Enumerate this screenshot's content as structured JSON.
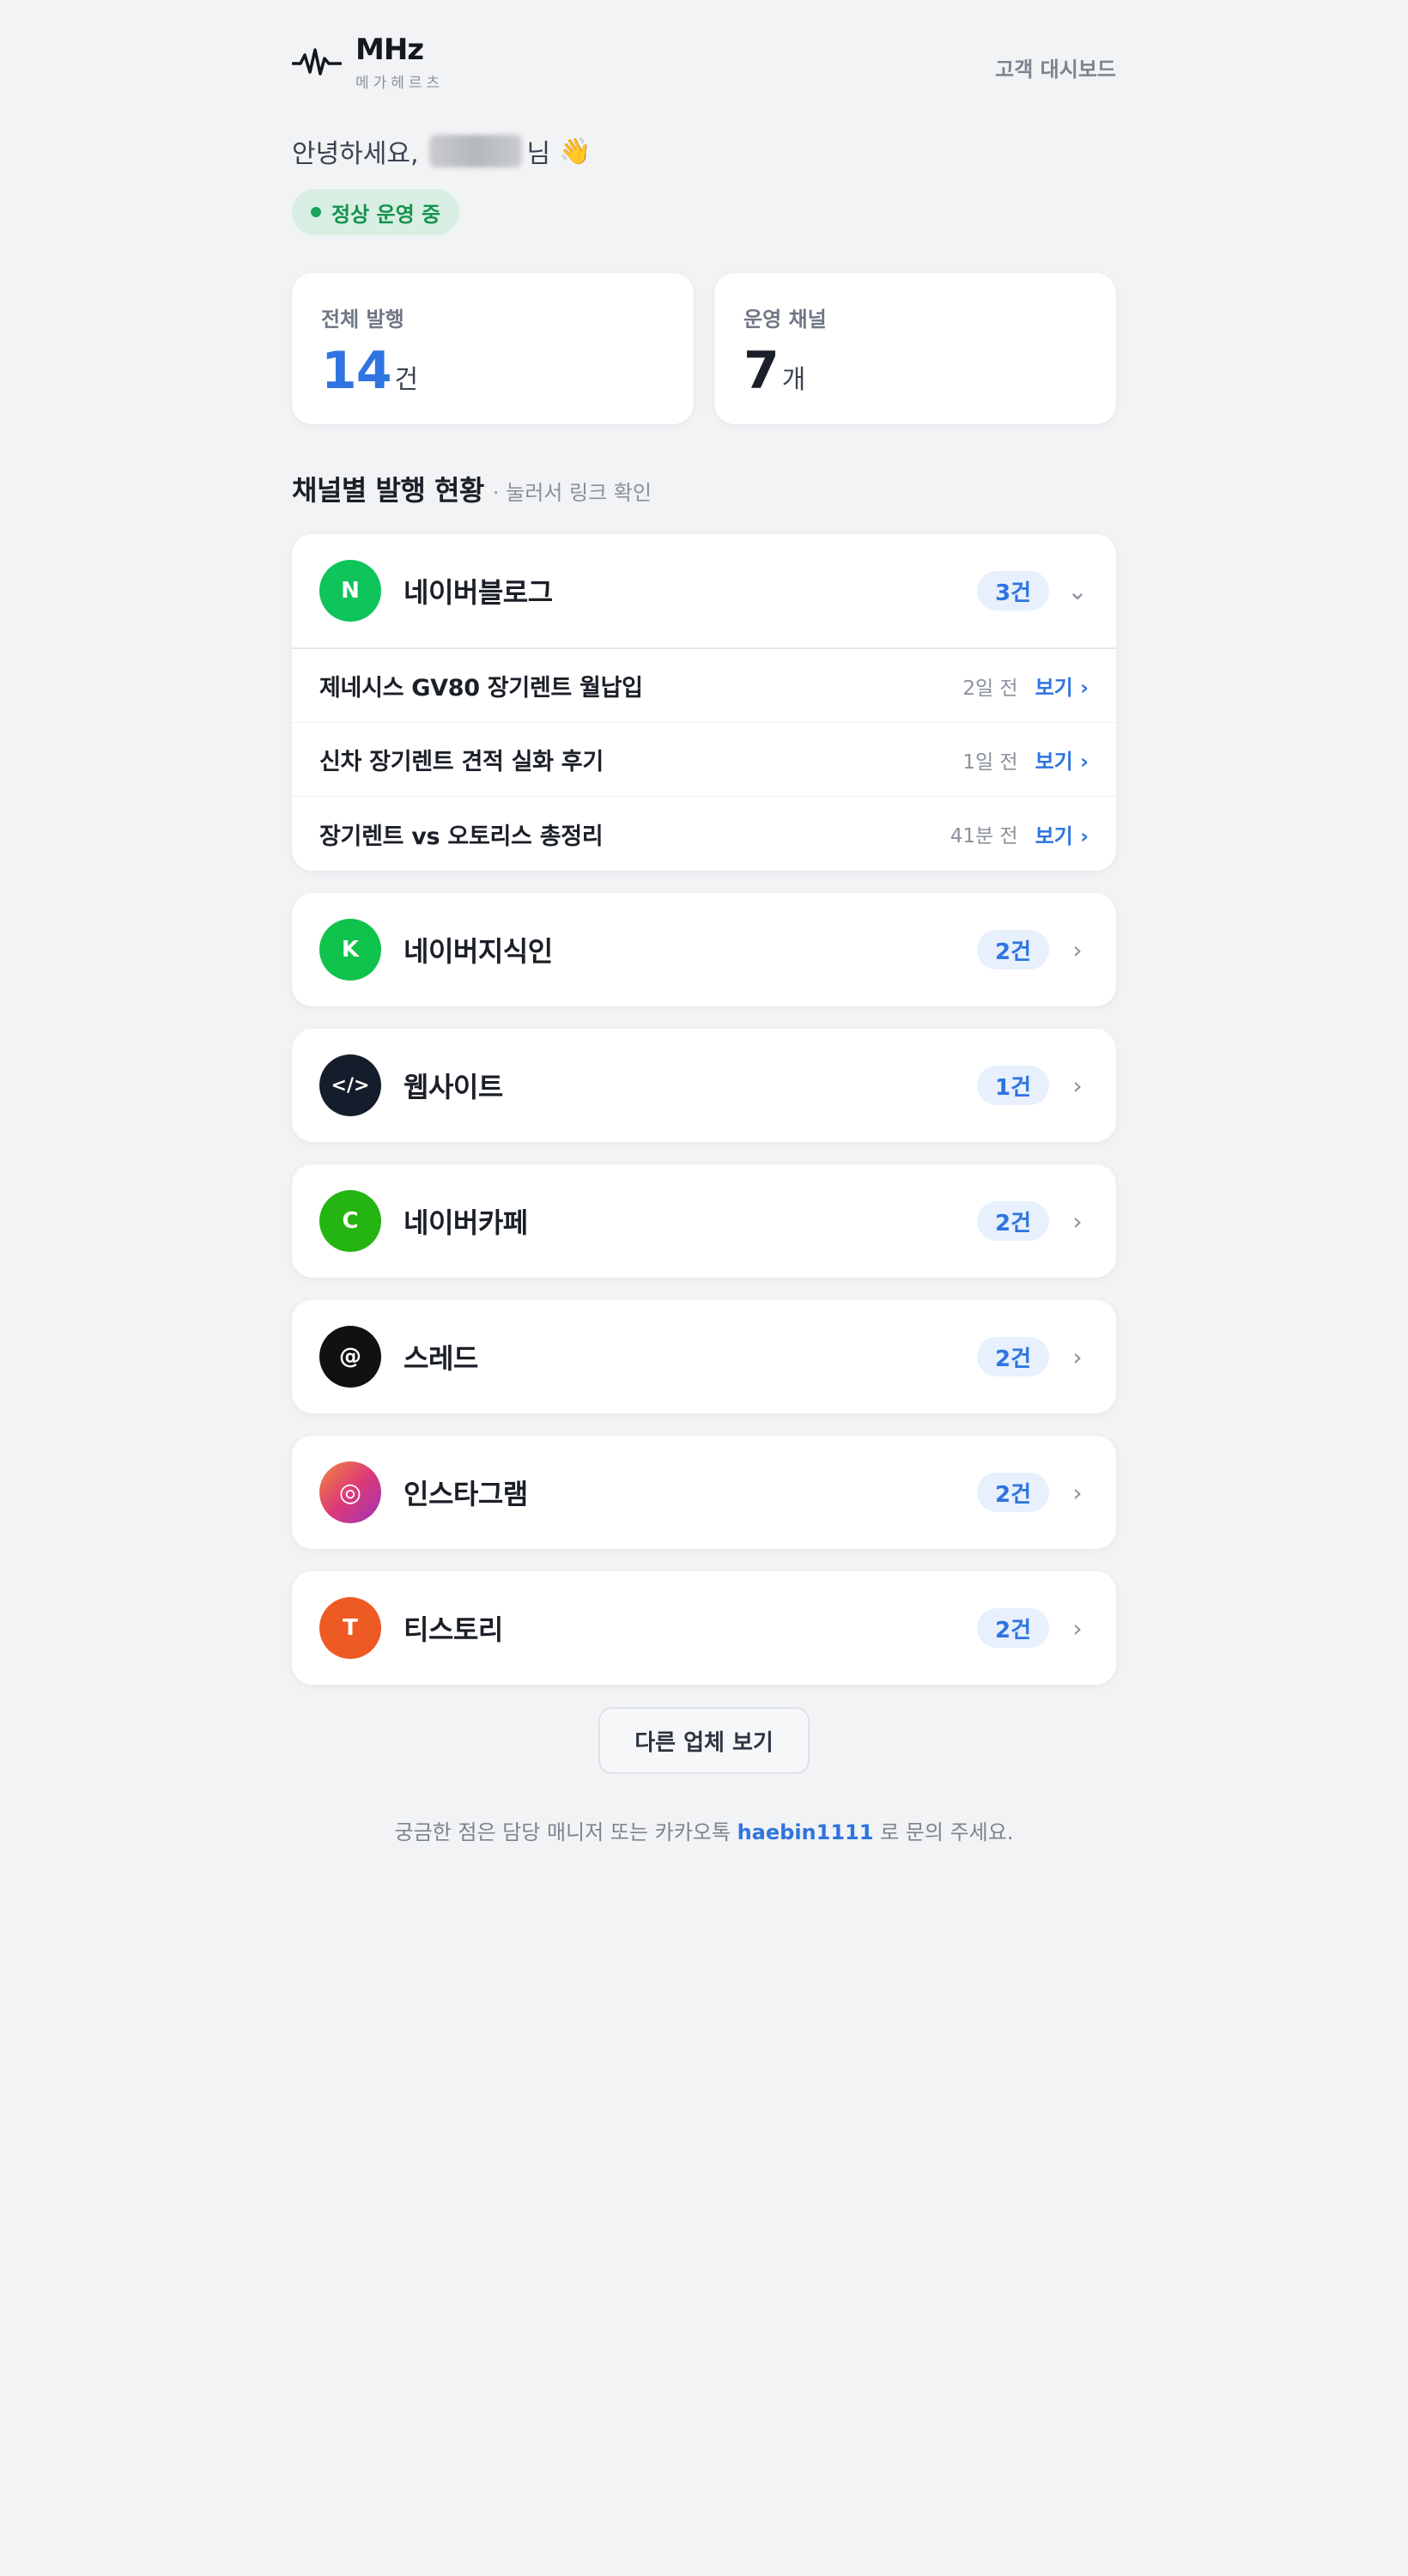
{
  "header": {
    "brand_name": "MHz",
    "brand_sub": "메가헤르츠",
    "dashboard_link": "고객 대시보드"
  },
  "greeting": {
    "prefix": "안녕하세요,",
    "suffix": "님",
    "emoji": "👋"
  },
  "status": {
    "label": "정상 운영 중",
    "color": "#1aa35c"
  },
  "stats": [
    {
      "label": "전체 발행",
      "value": "14",
      "unit": "건"
    },
    {
      "label": "운영 채널",
      "value": "7",
      "unit": "개"
    }
  ],
  "section": {
    "title": "채널별 발행 현황",
    "hint": "· 눌러서 링크 확인"
  },
  "channels": [
    {
      "initial": "N",
      "name": "네이버블로그",
      "count": "3건",
      "color": "#0fc45a",
      "expanded": true,
      "posts": [
        {
          "title": "제네시스 GV80 장기렌트 월납입",
          "time": "2일 전",
          "view": "보기 ›"
        },
        {
          "title": "신차 장기렌트 견적 실화 후기",
          "time": "1일 전",
          "view": "보기 ›"
        },
        {
          "title": "장기렌트 vs 오토리스 총정리",
          "time": "41분 전",
          "view": "보기 ›"
        }
      ]
    },
    {
      "initial": "K",
      "name": "네이버지식인",
      "count": "2건",
      "color": "#0ec24c"
    },
    {
      "initial": "</>",
      "name": "웹사이트",
      "count": "1건",
      "color": "#151c2c"
    },
    {
      "initial": "C",
      "name": "네이버카페",
      "count": "2건",
      "color": "#25b512"
    },
    {
      "initial": "@",
      "name": "스레드",
      "count": "2건",
      "color": "#111111"
    },
    {
      "initial": "◎",
      "name": "인스타그램",
      "count": "2건",
      "color": "#dd3a76"
    },
    {
      "initial": "T",
      "name": "티스토리",
      "count": "2건",
      "color": "#ee5a24"
    }
  ],
  "more_button": "다른 업체 보기",
  "footer": {
    "prefix": "궁금한 점은 담당 매니저 또는 카카오톡",
    "handle": "haebin1111",
    "suffix": "로 문의 주세요."
  },
  "icons": {
    "logo": "pulse-wave-icon",
    "chevron_expanded": "⌄",
    "chevron_collapsed": "›"
  }
}
